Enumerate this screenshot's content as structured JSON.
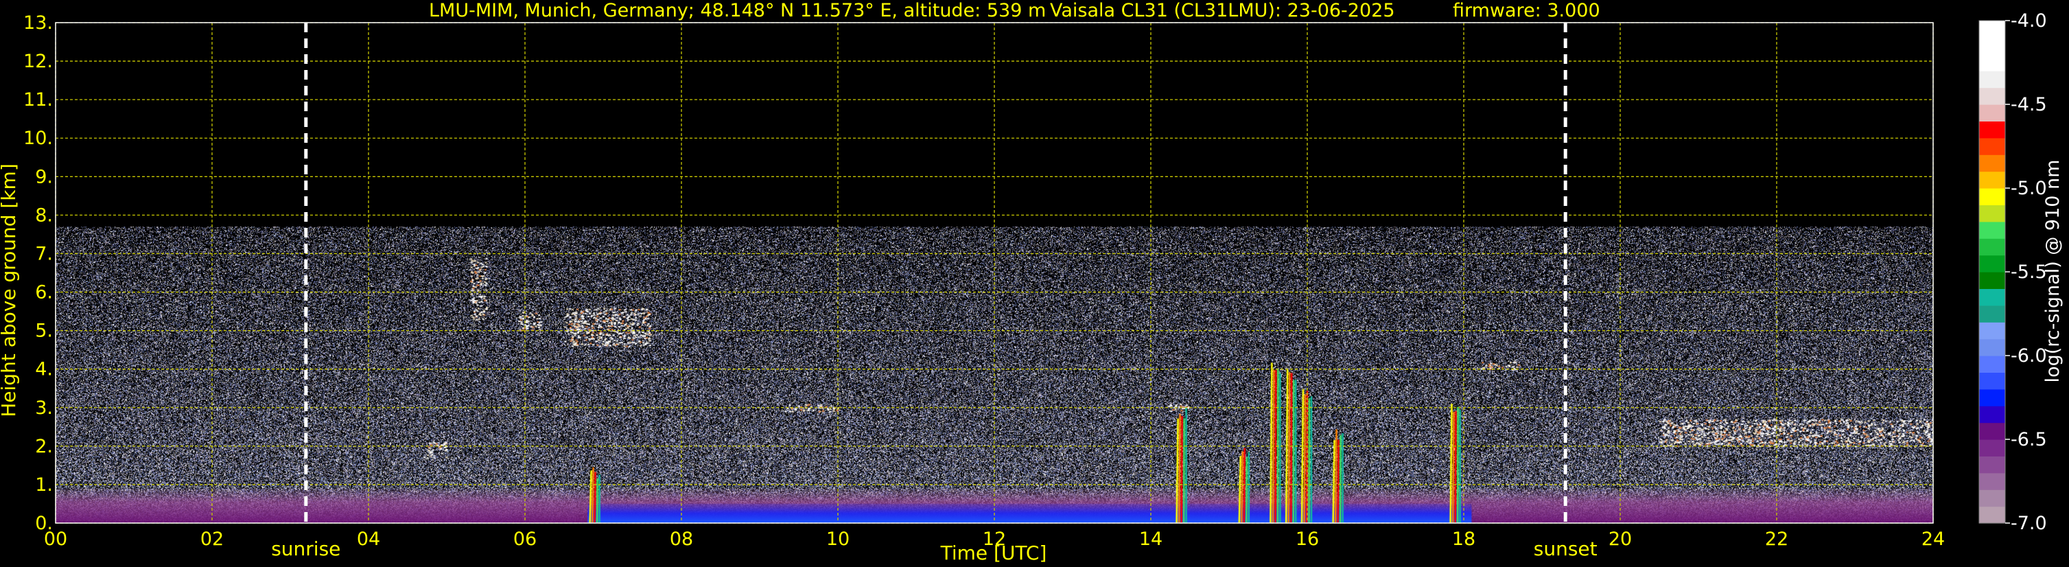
{
  "title_left": "LMU-MIM, Munich, Germany; 48.148° N 11.573° E, altitude: 539 m",
  "title_mid": "Vaisala CL31 (CL31LMU): 23-06-2025",
  "title_right": "firmware: 3.000",
  "colors": {
    "axis_text": "#ffff00",
    "grid": "#c8c800",
    "background": "#000000",
    "marker": "#ffffff",
    "colorbar_text": "#ffffff"
  },
  "chart_data": {
    "type": "heatmap",
    "xlabel": "Time [UTC]",
    "ylabel": "Height above ground [km]",
    "xlim": [
      0,
      24
    ],
    "ylim": [
      0,
      13
    ],
    "x_ticks": [
      {
        "v": 0,
        "label": "00"
      },
      {
        "v": 2,
        "label": "02"
      },
      {
        "v": 4,
        "label": "04"
      },
      {
        "v": 6,
        "label": "06"
      },
      {
        "v": 8,
        "label": "08"
      },
      {
        "v": 10,
        "label": "10"
      },
      {
        "v": 12,
        "label": "12"
      },
      {
        "v": 14,
        "label": "14"
      },
      {
        "v": 16,
        "label": "16"
      },
      {
        "v": 18,
        "label": "18"
      },
      {
        "v": 20,
        "label": "20"
      },
      {
        "v": 22,
        "label": "22"
      },
      {
        "v": 24,
        "label": "24"
      }
    ],
    "x_grid": [
      0,
      2,
      4,
      6,
      8,
      10,
      12,
      14,
      16,
      18,
      20,
      22,
      24
    ],
    "y_ticks": [
      {
        "v": 0,
        "label": "0."
      },
      {
        "v": 1,
        "label": "1."
      },
      {
        "v": 2,
        "label": "2."
      },
      {
        "v": 3,
        "label": "3."
      },
      {
        "v": 4,
        "label": "4."
      },
      {
        "v": 5,
        "label": "5."
      },
      {
        "v": 6,
        "label": "6."
      },
      {
        "v": 7,
        "label": "7."
      },
      {
        "v": 8,
        "label": "8."
      },
      {
        "v": 9,
        "label": "9."
      },
      {
        "v": 10,
        "label": "10."
      },
      {
        "v": 11,
        "label": "11."
      },
      {
        "v": 12,
        "label": "12."
      },
      {
        "v": 13,
        "label": "13."
      }
    ],
    "grid": true,
    "data_top_km": 7.7,
    "markers": [
      {
        "label": "sunrise",
        "time": 3.2
      },
      {
        "label": "sunset",
        "time": 19.3
      }
    ],
    "features": [
      {
        "type": "aerosol_layer",
        "t_start": 0,
        "t_end": 24,
        "top_km": 0.9
      },
      {
        "type": "blue_surface_band",
        "t_start": 6.8,
        "t_end": 18.1,
        "top_km": 0.5
      },
      {
        "type": "cloud_patch",
        "t_start": 5.3,
        "t_end": 5.5,
        "base_km": 5.3,
        "top_km": 6.9
      },
      {
        "type": "cloud_patch",
        "t_start": 5.9,
        "t_end": 6.2,
        "base_km": 5.0,
        "top_km": 5.5
      },
      {
        "type": "cloud_patch",
        "t_start": 6.5,
        "t_end": 7.6,
        "base_km": 4.6,
        "top_km": 5.6
      },
      {
        "type": "cloud_patch",
        "t_start": 4.7,
        "t_end": 5.0,
        "base_km": 1.7,
        "top_km": 2.1
      },
      {
        "type": "cloud_patch",
        "t_start": 9.3,
        "t_end": 10.0,
        "base_km": 2.9,
        "top_km": 3.1
      },
      {
        "type": "cloud_patch",
        "t_start": 14.2,
        "t_end": 14.5,
        "base_km": 2.9,
        "top_km": 3.1
      },
      {
        "type": "cloud_patch",
        "t_start": 18.2,
        "t_end": 18.7,
        "base_km": 4.0,
        "top_km": 4.2
      },
      {
        "type": "cloud_patch",
        "t_start": 20.5,
        "t_end": 24.0,
        "base_km": 2.0,
        "top_km": 2.7
      },
      {
        "type": "precip_streak",
        "t": 6.9,
        "top_km": 1.5
      },
      {
        "type": "precip_streak",
        "t": 14.4,
        "top_km": 3.0
      },
      {
        "type": "precip_streak",
        "t": 15.2,
        "top_km": 2.0
      },
      {
        "type": "precip_streak",
        "t": 15.6,
        "top_km": 4.2
      },
      {
        "type": "precip_streak",
        "t": 15.8,
        "top_km": 4.0
      },
      {
        "type": "precip_streak",
        "t": 16.0,
        "top_km": 3.5
      },
      {
        "type": "precip_streak",
        "t": 16.4,
        "top_km": 2.5
      },
      {
        "type": "precip_streak",
        "t": 17.9,
        "top_km": 3.2
      }
    ],
    "colorbar": {
      "label": "log(rc-signal) @ 910 nm",
      "range": [
        -7.0,
        -4.0
      ],
      "ticks": [
        {
          "v": -4.0,
          "label": "-4.0"
        },
        {
          "v": -4.5,
          "label": "-4.5"
        },
        {
          "v": -5.0,
          "label": "-5.0"
        },
        {
          "v": -5.5,
          "label": "-5.5"
        },
        {
          "v": -6.0,
          "label": "-6.0"
        },
        {
          "v": -6.5,
          "label": "-6.5"
        },
        {
          "v": -7.0,
          "label": "-7.0"
        }
      ],
      "colors": [
        "#b8a0b0",
        "#a888a8",
        "#9a6aa0",
        "#8a4a96",
        "#7a2a8c",
        "#6a1080",
        "#2a00c8",
        "#0020ff",
        "#3050ff",
        "#5a78ff",
        "#7090f0",
        "#80a0f8",
        "#1aa088",
        "#10b8a0",
        "#008000",
        "#00a020",
        "#20c040",
        "#40e060",
        "#c0e020",
        "#ffff00",
        "#ffc000",
        "#ff8000",
        "#ff4000",
        "#ff0000",
        "#e8b8b8",
        "#e8d8d8",
        "#f0f0f0",
        "#ffffff",
        "#ffffff",
        "#ffffff"
      ]
    }
  }
}
